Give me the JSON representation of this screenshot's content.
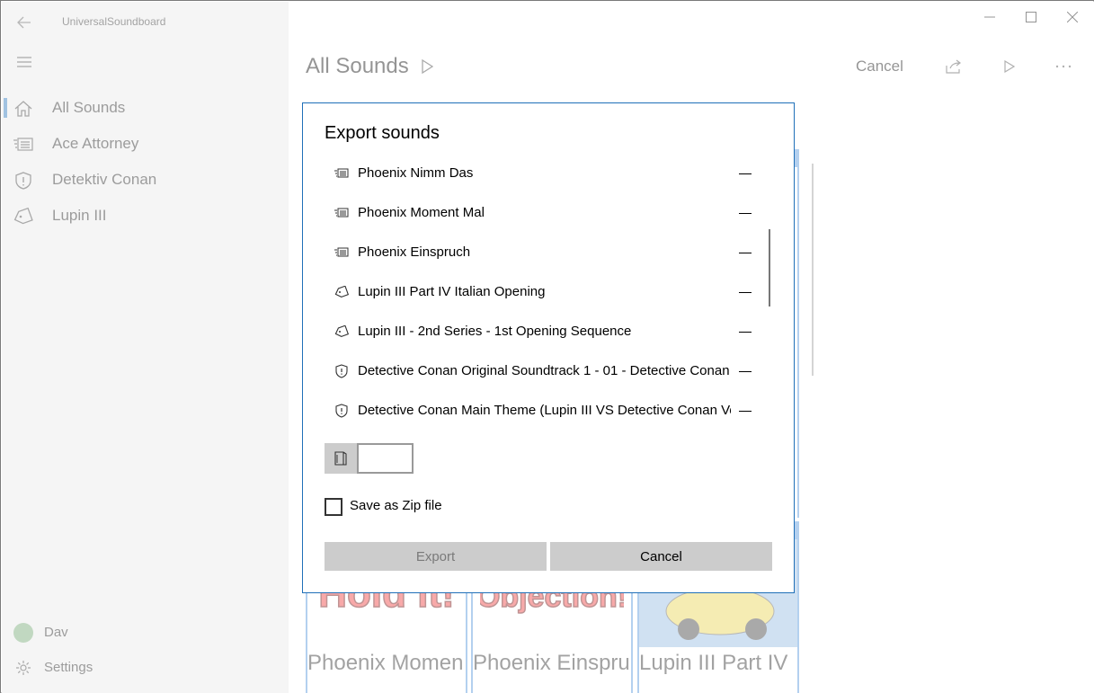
{
  "window": {
    "app_title": "UniversalSoundboard",
    "minimize_icon": "minimize-icon",
    "maximize_icon": "maximize-icon",
    "close_icon": "close-icon"
  },
  "sidebar": {
    "items": [
      {
        "label": "All Sounds",
        "icon": "home-icon",
        "selected": true
      },
      {
        "label": "Ace Attorney",
        "icon": "newspaper-icon",
        "selected": false
      },
      {
        "label": "Detektiv Conan",
        "icon": "shield-icon",
        "selected": false
      },
      {
        "label": "Lupin III",
        "icon": "tag-icon",
        "selected": false
      }
    ],
    "user": {
      "label": "Dav",
      "icon": "avatar"
    },
    "settings": {
      "label": "Settings",
      "icon": "gear-icon"
    }
  },
  "main": {
    "page_title": "All Sounds",
    "cancel_label": "Cancel",
    "tiles": [
      {
        "name": "Phoenix Momen",
        "caption": "Hold it!"
      },
      {
        "name": "Phoenix Einspru",
        "caption": "Objection!"
      },
      {
        "name": "Lupin III Part IV",
        "caption": ""
      }
    ]
  },
  "dialog": {
    "title": "Export sounds",
    "items": [
      {
        "label": "Phoenix Nimm Das",
        "icon": "newspaper-icon"
      },
      {
        "label": "Phoenix Moment Mal",
        "icon": "newspaper-icon"
      },
      {
        "label": "Phoenix Einspruch",
        "icon": "newspaper-icon"
      },
      {
        "label": "Lupin III Part IV  Italian Opening",
        "icon": "tag-icon"
      },
      {
        "label": "Lupin III - 2nd Series - 1st Opening Sequence",
        "icon": "tag-icon"
      },
      {
        "label": "Detective Conan Original Soundtrack 1 - 01 - Detective Conan",
        "icon": "shield-icon"
      },
      {
        "label": "Detective Conan Main Theme (Lupin III VS Detective Conan Version)",
        "icon": "shield-icon"
      }
    ],
    "folder_path_value": "",
    "save_as_zip_label": "Save as Zip file",
    "save_as_zip_checked": false,
    "export_label": "Export",
    "cancel_label": "Cancel"
  },
  "colors": {
    "accent": "#1f6fb8",
    "tile_border": "#4a90d9",
    "button_bg": "#cccccc"
  }
}
